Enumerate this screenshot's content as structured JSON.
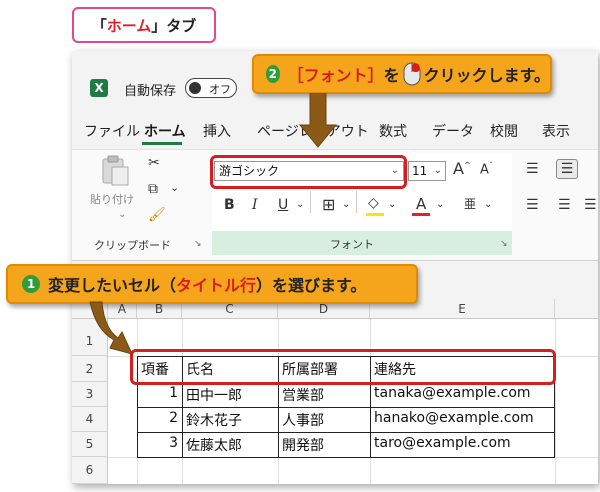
{
  "top_label": {
    "prefix": "「",
    "main": "ホーム",
    "suffix": "」タブ"
  },
  "title_bar": {
    "logo": "X",
    "autosave_label": "自動保存",
    "toggle_text": "オフ"
  },
  "tabs": [
    "ファイル",
    "ホーム",
    "挿入",
    "ページレイアウト",
    "数式",
    "データ",
    "校閲",
    "表示"
  ],
  "ribbon": {
    "clipboard": {
      "paste_label": "貼り付け",
      "group_label": "クリップボード"
    },
    "font": {
      "font_name": "游ゴシック",
      "font_size": "11",
      "group_label": "フォント",
      "phonetic_label": "亜"
    }
  },
  "sheet": {
    "columns": [
      "A",
      "B",
      "C",
      "D",
      "E"
    ],
    "rows": [
      "1",
      "2",
      "3",
      "4",
      "5",
      "6"
    ],
    "headers": [
      "項番",
      "氏名",
      "所属部署",
      "連絡先"
    ],
    "records": [
      [
        "1",
        "田中一郎",
        "営業部",
        "tanaka@example.com"
      ],
      [
        "2",
        "鈴木花子",
        "人事部",
        "hanako@example.com"
      ],
      [
        "3",
        "佐藤太郎",
        "開発部",
        "taro@example.com"
      ]
    ]
  },
  "callout1": {
    "num": "1",
    "text_a": "変更したいセル（",
    "emph": "タイトル行",
    "text_b": "）を選びます。"
  },
  "callout2": {
    "num": "2",
    "emph": "［フォント］",
    "text_a": "を",
    "text_b": "クリックします。"
  },
  "colors": {
    "accent_green": "#1f7a45",
    "callout_orange": "#f5a51c",
    "highlight_red": "#d61e1e",
    "label_pink": "#e2478f"
  }
}
